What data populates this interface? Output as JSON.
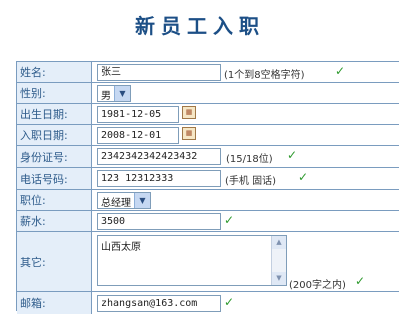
{
  "title": "新员工入职",
  "fields": {
    "name": {
      "label": "姓名:",
      "value": "张三",
      "hint": "(1个到8空格字符)"
    },
    "gender": {
      "label": "性别:",
      "value": "男"
    },
    "birth_date": {
      "label": "出生日期:",
      "value": "1981-12-05"
    },
    "join_date": {
      "label": "入职日期:",
      "value": "2008-12-01"
    },
    "id_number": {
      "label": "身份证号:",
      "value": "2342342342423432",
      "hint": "(15/18位)"
    },
    "phone": {
      "label": "电话号码:",
      "value": "123 12312333",
      "hint": "(手机 固话)"
    },
    "position": {
      "label": "职位:",
      "value": "总经理"
    },
    "salary": {
      "label": "薪水:",
      "value": "3500"
    },
    "remark": {
      "label": "其它:",
      "value": "山西太原",
      "hint": "(200字之内)"
    },
    "email": {
      "label": "邮箱:",
      "value": "zhangsan@163.com"
    }
  },
  "icons": {
    "check": "✓",
    "calendar": "calendar-icon",
    "dropdown": "▼"
  },
  "colors": {
    "title": "#1c4f86",
    "label_bg": "#e4eef9",
    "border": "#7a9cbf",
    "check": "#2e9a2e"
  }
}
